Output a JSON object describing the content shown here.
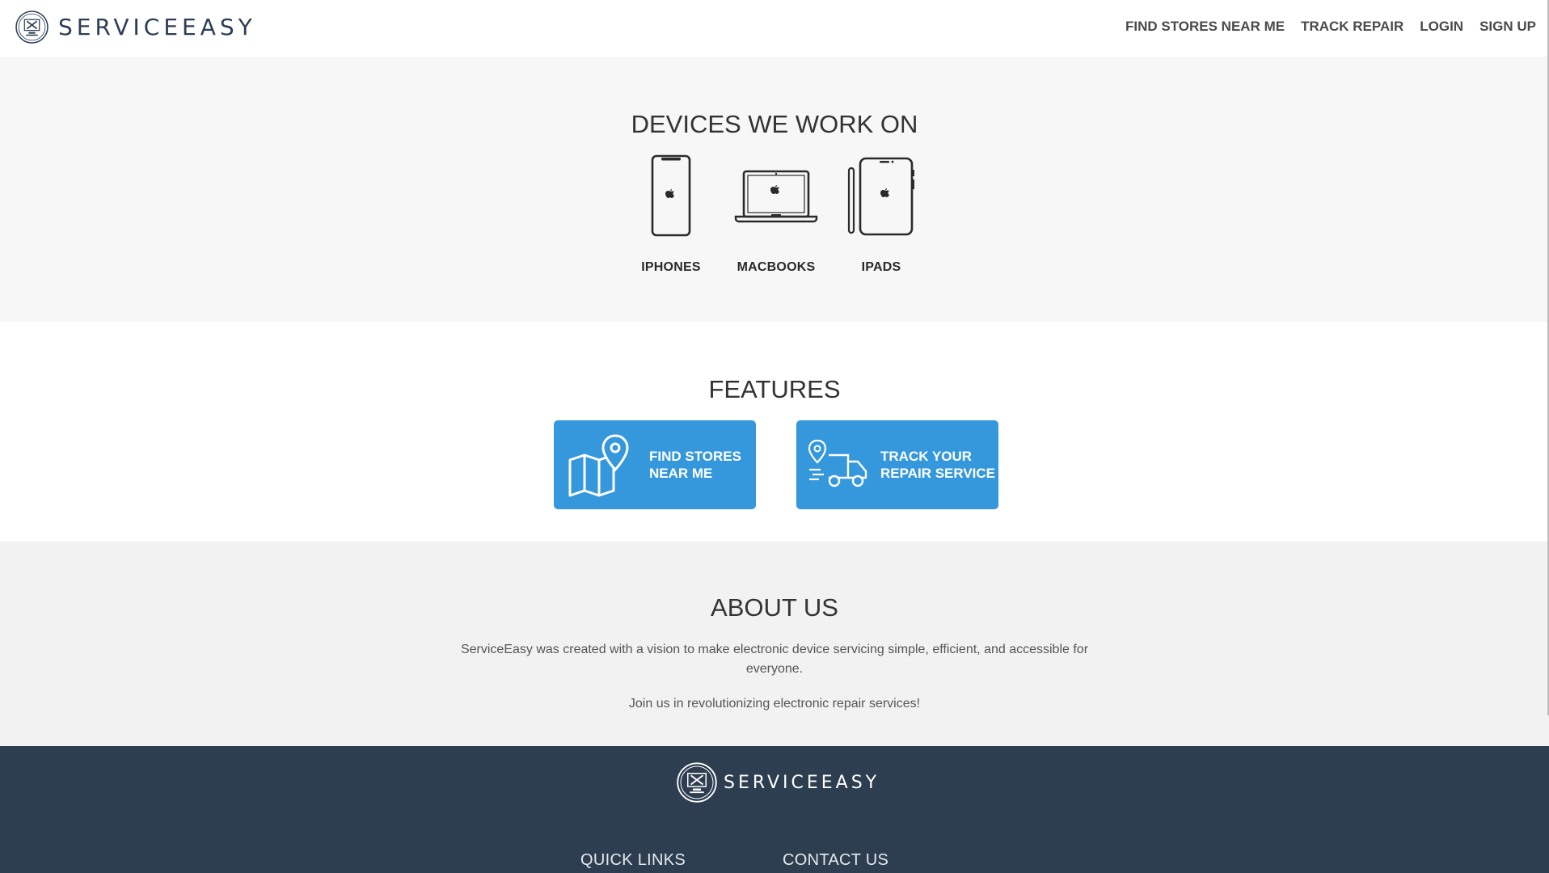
{
  "header": {
    "brand": "SERVICEEASY",
    "nav": [
      "FIND STORES NEAR ME",
      "TRACK REPAIR",
      "LOGIN",
      "SIGN UP"
    ]
  },
  "devices": {
    "title": "DEVICES WE WORK ON",
    "items": [
      {
        "label": "IPHONES",
        "icon": "iphone-icon"
      },
      {
        "label": "MACBOOKS",
        "icon": "macbook-icon"
      },
      {
        "label": "IPADS",
        "icon": "ipad-icon"
      }
    ]
  },
  "features": {
    "title": "FEATURES",
    "cards": [
      {
        "label": "FIND STORES\nNEAR ME",
        "icon": "map-pin-icon"
      },
      {
        "label": "TRACK YOUR\nREPAIR SERVICE",
        "icon": "delivery-truck-icon"
      }
    ]
  },
  "about": {
    "title": "ABOUT US",
    "paragraph1": "ServiceEasy was created with a vision to make electronic device servicing simple, efficient, and accessible for everyone.",
    "paragraph2": "Join us in revolutionizing electronic repair services!"
  },
  "footer": {
    "brand": "SERVICEEASY",
    "columns": [
      "QUICK LINKS",
      "CONTACT US"
    ]
  },
  "colors": {
    "primary": "#3598dc",
    "footer_bg": "#2c3e50",
    "brand_text": "#2c3e55"
  }
}
